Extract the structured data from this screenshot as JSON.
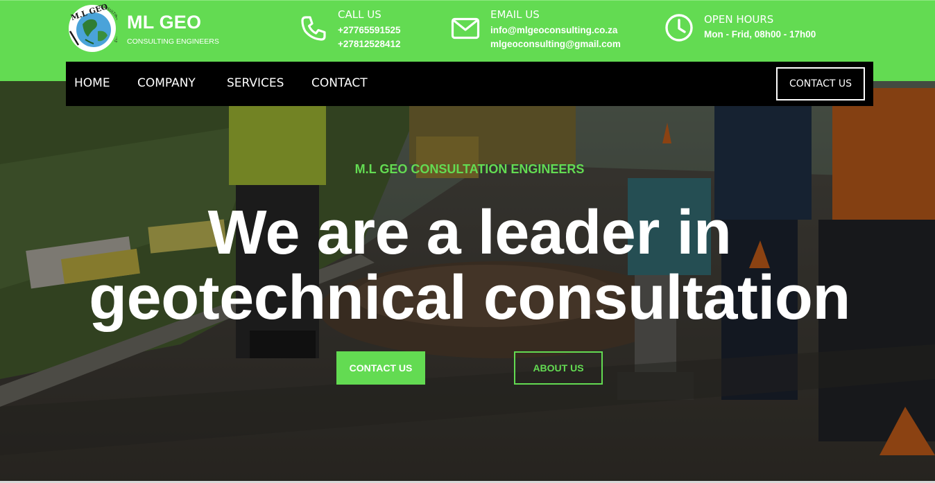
{
  "brand": {
    "logo_text": "M.L GEO",
    "logo_ring_text": "CONSULTING ENGINEERS",
    "title": "ML GEO",
    "subtitle": "CONSULTING ENGINEERS"
  },
  "contact_info": {
    "call": {
      "icon": "phone-icon",
      "title": "CALL US",
      "lines": [
        "+27765591525",
        "+27812528412"
      ]
    },
    "email": {
      "icon": "envelope-icon",
      "title": "EMAIL US",
      "lines": [
        "info@mlgeoconsulting.co.za",
        "mlgeoconsulting@gmail.com"
      ]
    },
    "hours": {
      "icon": "clock-icon",
      "title": "OPEN HOURS",
      "lines": [
        "Mon - Frid, 08h00 - 17h00"
      ]
    }
  },
  "nav": {
    "items": [
      {
        "label": "HOME"
      },
      {
        "label": "COMPANY"
      },
      {
        "label": "SERVICES"
      },
      {
        "label": "CONTACT"
      }
    ],
    "cta_label": "CONTACT US"
  },
  "hero": {
    "eyebrow": "M.L GEO CONSULTATION ENGINEERS",
    "headline_line1": "We are a leader in",
    "headline_line2": "geotechnical consultation",
    "primary_button": "CONTACT US",
    "secondary_button": "ABOUT US"
  },
  "colors": {
    "accent_green": "#63db52",
    "nav_background": "#000000",
    "text_light": "#ffffff"
  }
}
